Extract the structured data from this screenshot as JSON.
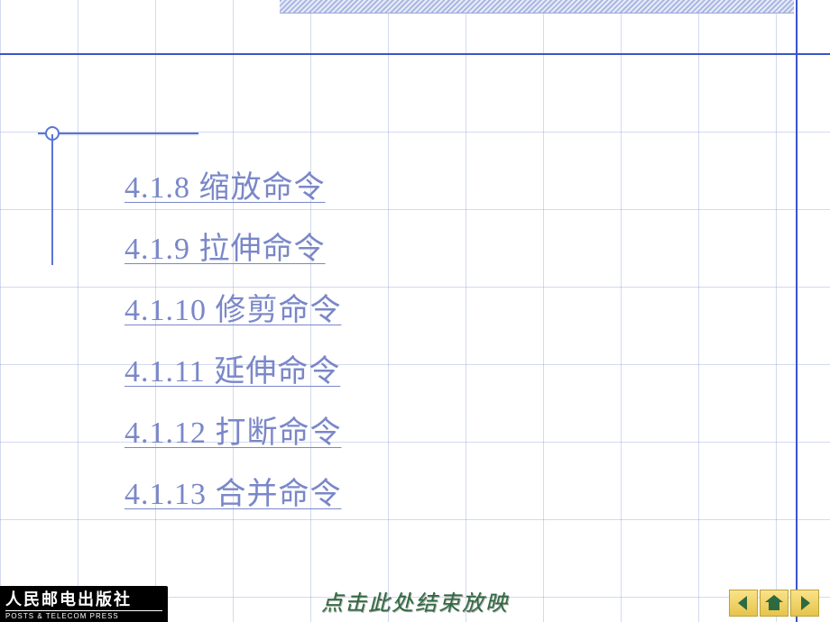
{
  "toc": {
    "items": [
      {
        "label": "4.1.8 缩放命令"
      },
      {
        "label": "4.1.9 拉伸命令"
      },
      {
        "label": "4.1.10 修剪命令"
      },
      {
        "label": "4.1.11 延伸命令"
      },
      {
        "label": "4.1.12 打断命令"
      },
      {
        "label": "4.1.13 合并命令"
      }
    ]
  },
  "footer": {
    "publisher_cn": "人民邮电出版社",
    "publisher_en": "POSTS & TELECOM PRESS",
    "end_show_label": "点击此处结束放映"
  },
  "nav_icons": {
    "prev": "chevron-left-icon",
    "home": "home-icon",
    "next": "chevron-right-icon"
  },
  "colors": {
    "link": "#7a87c8",
    "rule": "#3a55c8",
    "accent_green": "#2e6a3f",
    "button_fill": "#f2d66a"
  }
}
